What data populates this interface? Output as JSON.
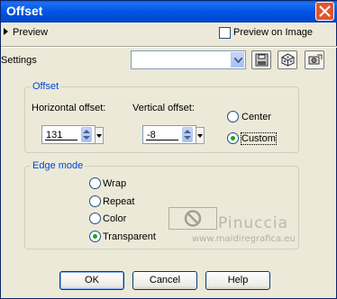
{
  "window": {
    "title": "Offset"
  },
  "preview": {
    "label": "Preview",
    "preview_on_image_label": "Preview on Image",
    "preview_on_image_checked": false
  },
  "settings": {
    "label": "Settings",
    "value": ""
  },
  "offset_group": {
    "title": "Offset",
    "horizontal_label": "Horizontal offset:",
    "horizontal_value": "131",
    "vertical_label": "Vertical offset:",
    "vertical_value": "-8",
    "center_label": "Center",
    "custom_label": "Custom",
    "selected": "Custom"
  },
  "edge_group": {
    "title": "Edge mode",
    "options": [
      "Wrap",
      "Repeat",
      "Color",
      "Transparent"
    ],
    "selected": "Transparent"
  },
  "watermark": {
    "line1": "Pinuccia",
    "line2": "www.maidiregrafica.eu"
  },
  "buttons": {
    "ok": "OK",
    "cancel": "Cancel",
    "help": "Help"
  },
  "colors": {
    "title_bar": "#0055e5",
    "group_title": "#0046d5",
    "dialog_bg": "#ece9d8",
    "close_button": "#e0552d",
    "radio_selected": "#21a121"
  }
}
